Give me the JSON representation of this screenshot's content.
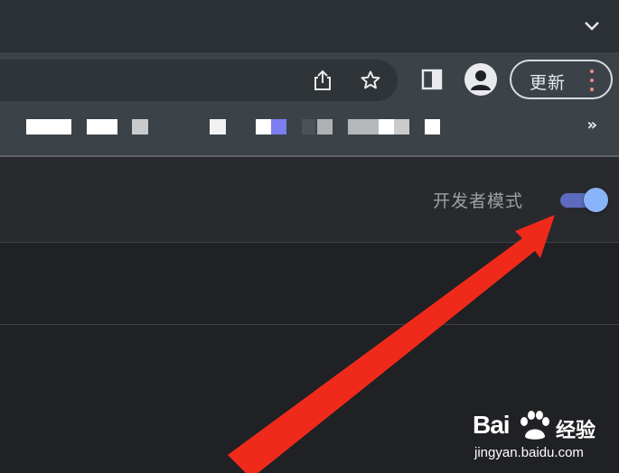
{
  "toolbar": {
    "update_label": "更新"
  },
  "header": {
    "developer_mode_label": "开发者模式",
    "developer_mode_enabled": true
  },
  "bookmarks_bar": {
    "more_label": "»"
  },
  "watermark": {
    "brand": "Bai",
    "product": "经验",
    "url": "jingyan.baidu.com"
  },
  "colors": {
    "toggle_track": "#5c6bbd",
    "toggle_thumb": "#8ab4f8",
    "arrow": "#f02a1a",
    "menu_dots": "#f28b82"
  }
}
